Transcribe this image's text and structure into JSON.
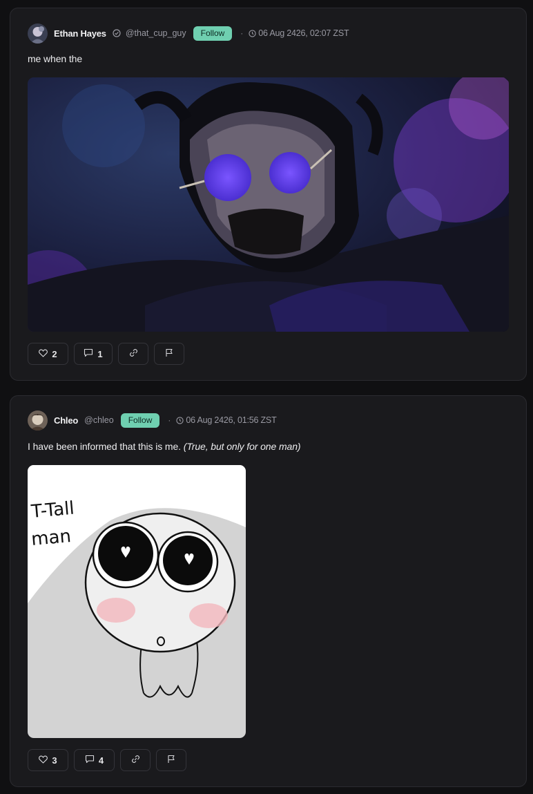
{
  "posts": [
    {
      "author": {
        "name": "Ethan Hayes",
        "handle": "@that_cup_guy",
        "verified": true
      },
      "follow_label": "Follow",
      "separator": "·",
      "timestamp": "06 Aug 2426, 02:07 ZST",
      "text": "me when the",
      "text_italic": "",
      "media_icon": "image-dark-character-purple-glasses",
      "likes": "2",
      "comments": "1"
    },
    {
      "author": {
        "name": "Chleo",
        "handle": "@chleo",
        "verified": false
      },
      "follow_label": "Follow",
      "separator": "·",
      "timestamp": "06 Aug 2426, 01:56 ZST",
      "text": "I have been informed that this is me.",
      "text_italic": "(True, but only for one man)",
      "media_text_line1": "T-Tall",
      "media_text_line2": "man",
      "likes": "3",
      "comments": "4"
    }
  ],
  "colors": {
    "background": "#101012",
    "card": "#1a1a1d",
    "follow_accent": "#6fcfb0",
    "muted_text": "#9a9aa3"
  }
}
